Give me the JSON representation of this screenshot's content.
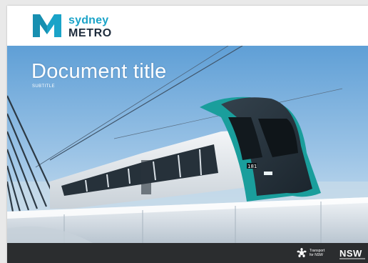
{
  "header": {
    "logo_line1": "sydney",
    "logo_line2": "METRO"
  },
  "cover": {
    "title": "Document title",
    "subtitle": "SUBTITLE"
  },
  "footer": {
    "transport_line1": "Transport",
    "transport_line2": "for NSW",
    "nsw_logo": "NSW"
  },
  "colors": {
    "metro_teal": "#1aa3c8",
    "metro_navy": "#1f2d3d",
    "footer_bg": "#2b2d2f"
  },
  "icons": {
    "metro_mark": "metro-m-icon",
    "waratah": "waratah-icon"
  }
}
